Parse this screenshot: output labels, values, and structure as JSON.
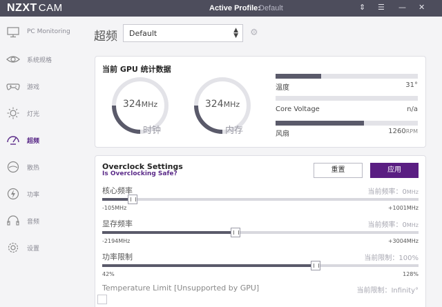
{
  "titlebar": {
    "brand": "NZXT",
    "product": "CAM",
    "profile_label": "Active Profile:",
    "profile_value": "Default"
  },
  "sidebar": {
    "items": [
      {
        "label": "PC Monitoring",
        "icon": "monitor-icon"
      },
      {
        "label": "系统规格",
        "icon": "eye-icon"
      },
      {
        "label": "游戏",
        "icon": "gamepad-icon"
      },
      {
        "label": "灯光",
        "icon": "sun-icon"
      },
      {
        "label": "超频",
        "icon": "speedometer-icon",
        "active": true
      },
      {
        "label": "散热",
        "icon": "thermometer-icon"
      },
      {
        "label": "功率",
        "icon": "power-icon"
      },
      {
        "label": "音频",
        "icon": "headset-icon"
      },
      {
        "label": "设置",
        "icon": "gear-icon"
      }
    ]
  },
  "page": {
    "title": "超频",
    "profile_select": "Default"
  },
  "gpu_stats": {
    "title": "当前 GPU 统计数据",
    "core_clock": {
      "value": "324",
      "unit": "MHz",
      "label": "时钟"
    },
    "memory_clock": {
      "value": "324",
      "unit": "MHz",
      "label": "内存"
    },
    "temperature": {
      "label": "温度",
      "value": "31°",
      "level": 0.32
    },
    "core_voltage": {
      "label": "Core Voltage",
      "value": "n/a",
      "level": 0
    },
    "fan": {
      "label": "风扇",
      "value": "1260",
      "unit": "RPM",
      "level": 0.62
    }
  },
  "overclock": {
    "title": "Overclock Settings",
    "safety_link": "Is Overclocking Safe?",
    "reset_label": "重置",
    "apply_label": "应用",
    "core": {
      "label": "核心频率",
      "current_label": "当前频率：",
      "current_value": "0",
      "current_unit": "MHz",
      "min": "-105MHz",
      "max": "+1001MHz",
      "position": 0.095
    },
    "memory": {
      "label": "显存频率",
      "current_label": "当前频率：",
      "current_value": "0",
      "current_unit": "MHz",
      "min": "-2194MHz",
      "max": "+3004MHz",
      "position": 0.422
    },
    "power": {
      "label": "功率限制",
      "current_label": "当前限制：",
      "current_value": "100%",
      "min": "42%",
      "max": "128%",
      "position": 0.675
    },
    "temperature": {
      "label": "Temperature Limit [Unsupported by GPU]",
      "current_label": "当前限制：",
      "current_value": "Infinity°"
    }
  },
  "colors": {
    "accent": "#5a1e82",
    "titlebar": "#4d4d5c",
    "fill": "#5a5a6a"
  }
}
